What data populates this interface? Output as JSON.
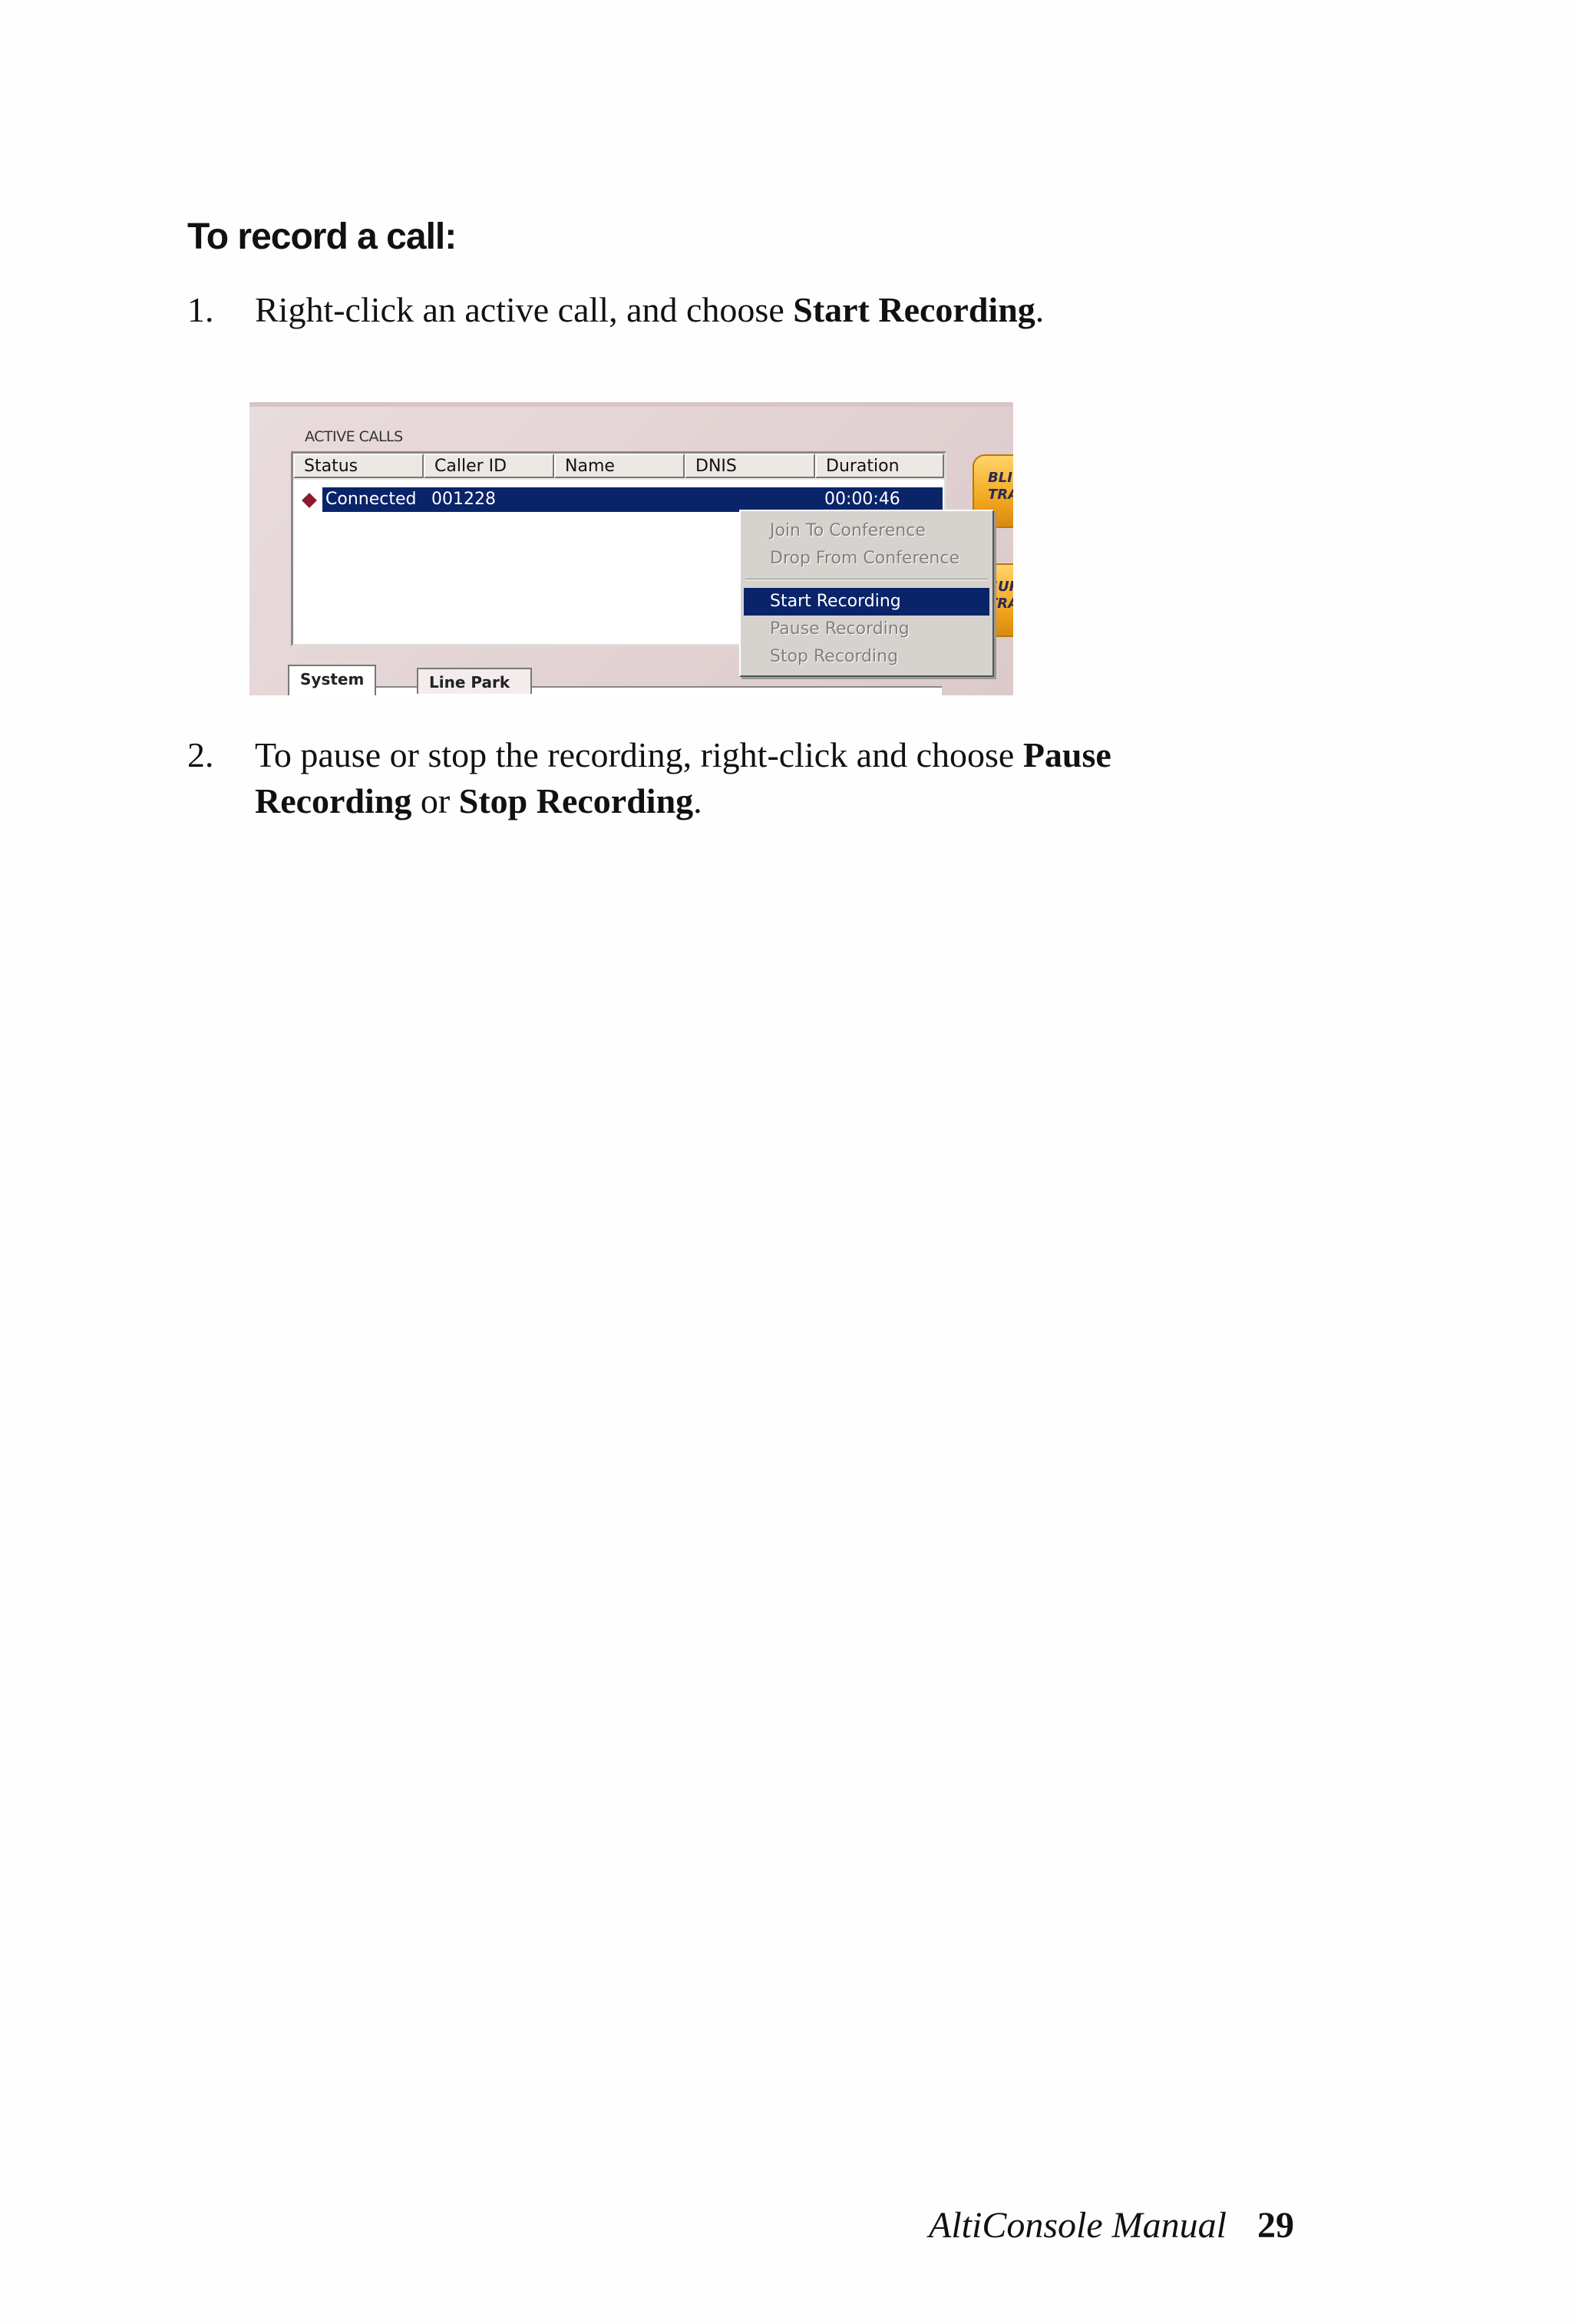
{
  "heading": "To record a call:",
  "steps": [
    {
      "number": "1.",
      "parts": [
        "Right-click an active call, and choose ",
        "Start Recording",
        "."
      ]
    },
    {
      "number": "2.",
      "parts": [
        "To pause or stop the recording, right-click and choose ",
        "Pause",
        "Recording",
        " or ",
        "Stop Recording",
        "."
      ]
    }
  ],
  "figure": {
    "panel_title": "ACTIVE CALLS",
    "columns": [
      "Status",
      "Caller ID",
      "Name",
      "DNIS",
      "Duration"
    ],
    "row": {
      "status": "Connected",
      "caller_id": "001228",
      "duration": "00:00:46"
    },
    "menu_items": [
      "Join To Conference",
      "Drop From Conference",
      "Start Recording",
      "Pause Recording",
      "Stop  Recording"
    ],
    "active_menu_item": "Start Recording",
    "tabs": [
      "System Park",
      "Line Park"
    ],
    "side_buttons": [
      "BLI\nTRA",
      "SUP\nTRA"
    ],
    "accent_color": "#0a246a",
    "button_color": "#f3a81f"
  },
  "footer": {
    "manual": "AltiConsole Manual",
    "page": "29"
  }
}
